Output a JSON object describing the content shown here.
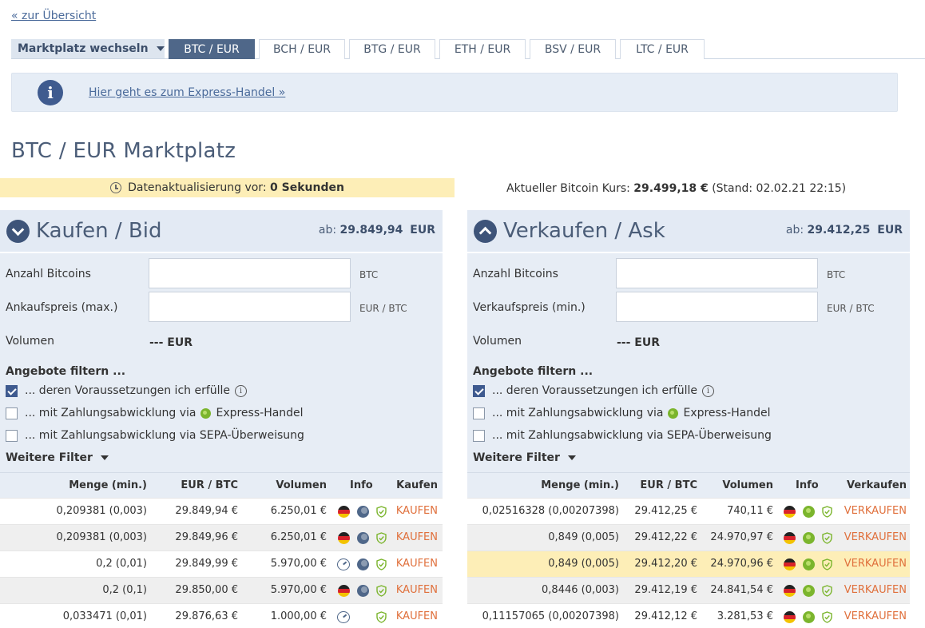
{
  "nav": {
    "back_label": "« zur Übersicht"
  },
  "tabs": {
    "switch_label": "Marktplatz wechseln",
    "items": [
      "BTC / EUR",
      "BCH / EUR",
      "BTG / EUR",
      "ETH / EUR",
      "BSV / EUR",
      "LTC / EUR"
    ],
    "active": "BTC / EUR"
  },
  "info": {
    "link_label": "Hier geht es zum Express-Handel »"
  },
  "page": {
    "title": "BTC / EUR Marktplatz"
  },
  "status": {
    "update_prefix": "Datenaktualisierung vor:",
    "update_value": "0 Sekunden",
    "rate_prefix": "Aktueller Bitcoin Kurs:",
    "rate_value": "29.499,18 €",
    "rate_suffix": "(Stand: 02.02.21 22:15)"
  },
  "bid": {
    "title": "Kaufen / Bid",
    "from_label": "ab:",
    "from_value": "29.849,94",
    "from_unit": "EUR",
    "amount_label": "Anzahl Bitcoins",
    "amount_unit": "BTC",
    "price_label": "Ankaufspreis (max.)",
    "price_unit": "EUR / BTC",
    "volume_label": "Volumen",
    "volume_value": "--- EUR",
    "filter_title": "Angebote filtern ...",
    "filter_1": "... deren Voraussetzungen ich erfülle",
    "filter_2_prefix": "... mit Zahlungsabwicklung via",
    "filter_2_suffix": "Express-Handel",
    "filter_3": "... mit Zahlungsabwicklung via SEPA-Überweisung",
    "more_filter": "Weitere Filter",
    "headers": {
      "qty": "Menge (min.)",
      "price": "EUR / BTC",
      "volume": "Volumen",
      "info": "Info",
      "action": "Kaufen"
    },
    "rows": [
      {
        "qty": "0,209381 (0,003)",
        "price": "29.849,94 €",
        "volume": "6.250,01 €",
        "action": "KAUFEN"
      },
      {
        "qty": "0,209381 (0,003)",
        "price": "29.849,96 €",
        "volume": "6.250,01 €",
        "action": "KAUFEN"
      },
      {
        "qty": "0,2 (0,01)",
        "price": "29.849,99 €",
        "volume": "5.970,00 €",
        "action": "KAUFEN"
      },
      {
        "qty": "0,2 (0,1)",
        "price": "29.850,00 €",
        "volume": "5.970,00 €",
        "action": "KAUFEN"
      },
      {
        "qty": "0,033471 (0,01)",
        "price": "29.876,63 €",
        "volume": "1.000,00 €",
        "action": "KAUFEN"
      }
    ]
  },
  "ask": {
    "title": "Verkaufen / Ask",
    "from_label": "ab:",
    "from_value": "29.412,25",
    "from_unit": "EUR",
    "amount_label": "Anzahl Bitcoins",
    "amount_unit": "BTC",
    "price_label": "Verkaufspreis (min.)",
    "price_unit": "EUR / BTC",
    "volume_label": "Volumen",
    "volume_value": "--- EUR",
    "filter_title": "Angebote filtern ...",
    "filter_1": "... deren Voraussetzungen ich erfülle",
    "filter_2_prefix": "... mit Zahlungsabwicklung via",
    "filter_2_suffix": "Express-Handel",
    "filter_3": "... mit Zahlungsabwicklung via SEPA-Überweisung",
    "more_filter": "Weitere Filter",
    "headers": {
      "qty": "Menge (min.)",
      "price": "EUR / BTC",
      "volume": "Volumen",
      "info": "Info",
      "action": "Verkaufen"
    },
    "rows": [
      {
        "qty": "0,02516328 (0,00207398)",
        "price": "29.412,25 €",
        "volume": "740,11 €",
        "action": "VERKAUFEN"
      },
      {
        "qty": "0,849 (0,005)",
        "price": "29.412,22 €",
        "volume": "24.970,97 €",
        "action": "VERKAUFEN"
      },
      {
        "qty": "0,849 (0,005)",
        "price": "29.412,20 €",
        "volume": "24.970,96 €",
        "action": "VERKAUFEN"
      },
      {
        "qty": "0,8446 (0,003)",
        "price": "29.412,19 €",
        "volume": "24.841,54 €",
        "action": "VERKAUFEN"
      },
      {
        "qty": "0,11157065 (0,00207398)",
        "price": "29.412,12 €",
        "volume": "3.281,53 €",
        "action": "VERKAUFEN"
      }
    ]
  },
  "colors": {
    "accent": "#4f6789",
    "action": "#e0703c",
    "highlight": "#fdeeb7",
    "panel": "#e7edf5"
  },
  "icons": {
    "flag": "german-flag-icon",
    "express": "express-handel-icon",
    "trust": "shield-check-icon",
    "speed": "gauge-icon"
  }
}
